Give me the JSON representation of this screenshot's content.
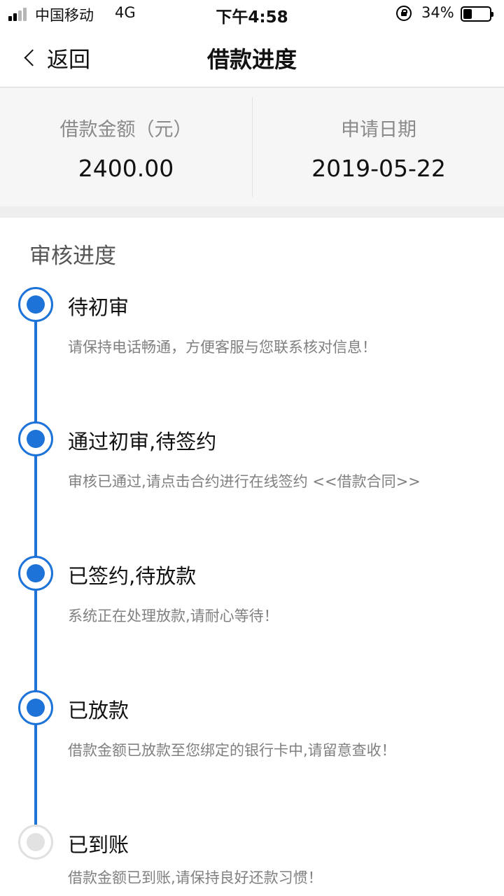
{
  "status_bar": {
    "carrier": "中国移动",
    "network": "4G",
    "time": "下午4:58",
    "battery": "34%",
    "battery_level": 0.34
  },
  "nav": {
    "back_label": "返回",
    "title": "借款进度"
  },
  "summary": {
    "amount_label": "借款金额（元）",
    "amount_value": "2400.00",
    "date_label": "申请日期",
    "date_value": "2019-05-22"
  },
  "progress": {
    "section_title": "审核进度",
    "steps": [
      {
        "title": "待初审",
        "desc": "请保持电话畅通，方便客服与您联系核对信息！",
        "done": true
      },
      {
        "title": "通过初审,待签约",
        "desc": "审核已通过,请点击合约进行在线签约",
        "link": "<<借款合同>>",
        "done": true
      },
      {
        "title": "已签约,待放款",
        "desc": "系统正在处理放款,请耐心等待！",
        "done": true
      },
      {
        "title": "已放款",
        "desc": "借款金额已放款至您绑定的银行卡中,请留意查收！",
        "done": true
      },
      {
        "title": "已到账",
        "desc": "借款金额已到账,请保持良好还款习惯！",
        "done": false
      }
    ]
  },
  "colors": {
    "accent": "#1e73d9",
    "pending": "#e2e2e2"
  }
}
